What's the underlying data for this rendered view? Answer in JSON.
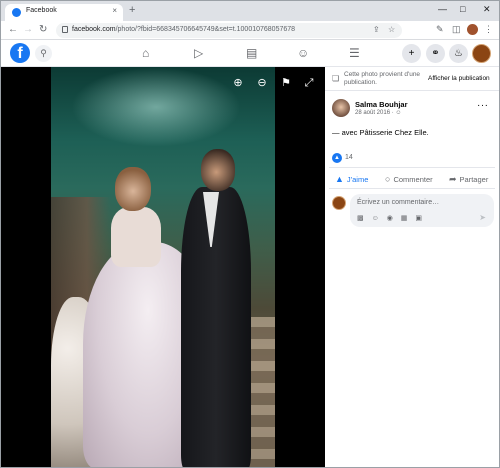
{
  "browser": {
    "tab_title": "Facebook",
    "tab_close": "×",
    "new_tab": "+",
    "url_host": "facebook.com",
    "url_rest": "/photo/?fbid=668345706645749&set=t.100010768057678",
    "icons": [
      "back-icon",
      "forward-icon",
      "reload-icon",
      "share-icon",
      "star-icon",
      "extensions-icon",
      "sidepanel-icon",
      "menu-icon"
    ]
  },
  "facebook": {
    "logo": "f",
    "nav_icons": [
      "home-icon",
      "watch-icon",
      "marketplace-icon",
      "groups-icon",
      "menu-icon"
    ],
    "right_icons": [
      "create-icon",
      "messenger-icon",
      "notifications-icon"
    ]
  },
  "post": {
    "notice_text": "Cette photo provient d'une publication.",
    "notice_link": "Afficher la publication",
    "author": "Salma Bouhjar",
    "date": "28 août 2016 · ",
    "more": "···",
    "caption": "— avec Pâtisserie Chez Elle.",
    "like_count": "14",
    "actions": {
      "like": "J'aime",
      "comment": "Commenter",
      "share": "Partager"
    },
    "comment_placeholder": "Écrivez un commentaire…"
  },
  "colors": {
    "facebook_blue": "#1877f2",
    "viewer_bg": "#000000"
  }
}
